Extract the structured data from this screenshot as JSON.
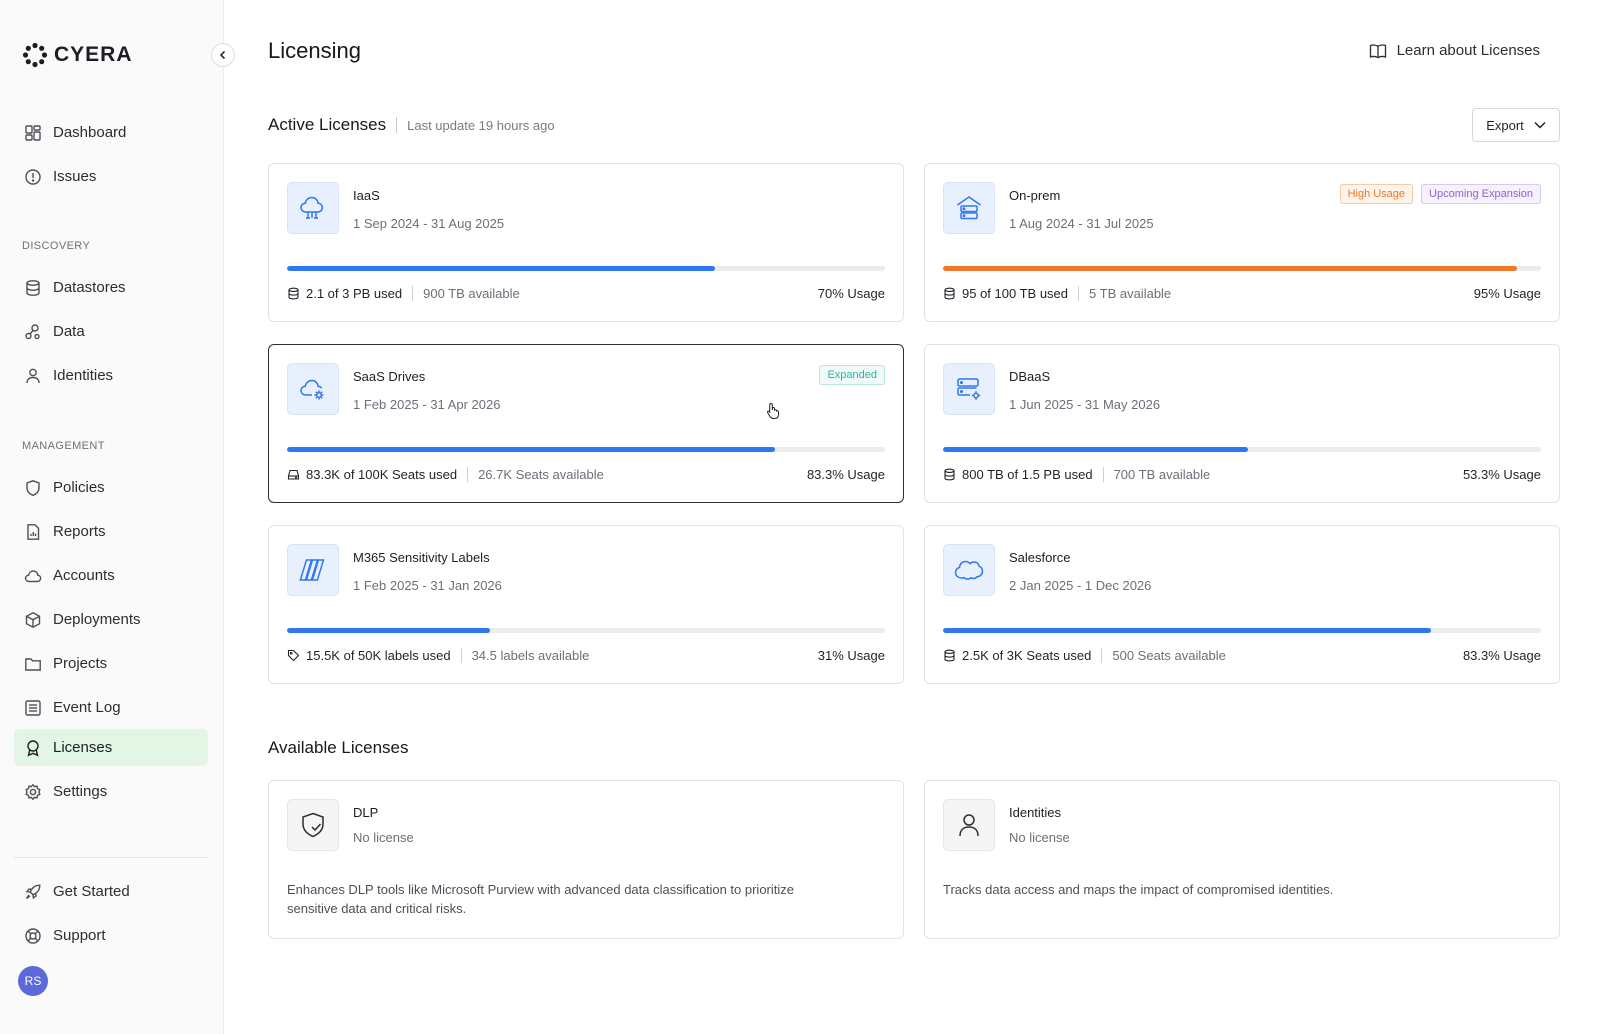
{
  "sidebar": {
    "logo": "CYERA",
    "items_top": [
      {
        "label": "Dashboard"
      },
      {
        "label": "Issues"
      }
    ],
    "discovery_label": "DISCOVERY",
    "discovery_items": [
      {
        "label": "Datastores"
      },
      {
        "label": "Data"
      },
      {
        "label": "Identities"
      }
    ],
    "management_label": "MANAGEMENT",
    "management_items": [
      {
        "label": "Policies"
      },
      {
        "label": "Reports"
      },
      {
        "label": "Accounts"
      },
      {
        "label": "Deployments"
      },
      {
        "label": "Projects"
      },
      {
        "label": "Event Log"
      },
      {
        "label": "Licenses",
        "active": true
      },
      {
        "label": "Settings"
      }
    ],
    "footer_items": [
      {
        "label": "Get Started"
      },
      {
        "label": "Support"
      }
    ],
    "avatar_initials": "RS",
    "active_color": "#e3f6e6"
  },
  "header": {
    "title": "Licensing",
    "learn_link": "Learn about Licenses"
  },
  "active_section": {
    "title": "Active Licenses",
    "last_update": "Last update 19 hours ago",
    "export_label": "Export"
  },
  "active_licenses": [
    {
      "name": "IaaS",
      "dates": "1 Sep 2024 - 31 Aug 2025",
      "used": "2.1 of 3 PB used",
      "available": "900 TB available",
      "usage": "70% Usage",
      "usage_fraction": 0.716,
      "badges": []
    },
    {
      "name": "On-prem",
      "dates": "1 Aug 2024 - 31 Jul 2025",
      "used": "95 of 100 TB used",
      "available": "5 TB available",
      "usage": "95% Usage",
      "usage_fraction": 0.96,
      "badges": [
        {
          "label": "High Usage",
          "style": "orange"
        },
        {
          "label": "Upcoming Expansion",
          "style": "purple"
        }
      ]
    },
    {
      "name": "SaaS Drives",
      "dates": "1 Feb 2025 - 31 Apr 2026",
      "used": "83.3K of 100K Seats used",
      "available": "26.7K Seats available",
      "usage": "83.3% Usage",
      "usage_fraction": 0.816,
      "badges": [
        {
          "label": "Expanded",
          "style": "teal"
        }
      ]
    },
    {
      "name": "DBaaS",
      "dates": "1 Jun 2025 - 31 May 2026",
      "used": "800 TB of 1.5 PB used",
      "available": "700 TB available",
      "usage": "53.3% Usage",
      "usage_fraction": 0.51,
      "badges": []
    },
    {
      "name": "M365 Sensitivity Labels",
      "dates": "1 Feb 2025 - 31 Jan 2026",
      "used": "15.5K of 50K labels used",
      "available": "34.5 labels available",
      "usage": "31% Usage",
      "usage_fraction": 0.34,
      "badges": []
    },
    {
      "name": "Salesforce",
      "dates": "2 Jan 2025 - 1 Dec 2026",
      "used": "2.5K of 3K Seats used",
      "available": "500 Seats available",
      "usage": "83.3% Usage",
      "usage_fraction": 0.816,
      "badges": []
    }
  ],
  "available_section": {
    "title": "Available Licenses"
  },
  "available_licenses": [
    {
      "name": "DLP",
      "status": "No license",
      "description": "Enhances DLP tools like Microsoft Purview with advanced data classification to prioritize sensitive data and critical risks."
    },
    {
      "name": "Identities",
      "status": "No license",
      "description": "Tracks data access and maps the impact of compromised identities."
    }
  ],
  "colors": {
    "accent_blue": "#2f77ee",
    "warning_orange": "#f0782c"
  }
}
